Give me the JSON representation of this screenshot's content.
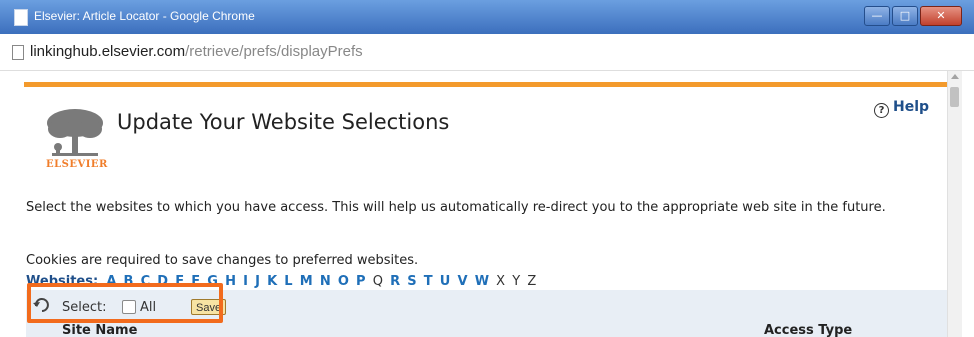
{
  "window": {
    "title": "Elsevier: Article Locator - Google Chrome"
  },
  "address_bar": {
    "host": "linkinghub.elsevier.com",
    "path": "/retrieve/prefs/displayPrefs"
  },
  "page": {
    "logo_text": "ELSEVIER",
    "heading": "Update Your Website Selections",
    "help_label": "Help",
    "intro": "Select the websites to which you have access. This will help us automatically re-direct you to the appropriate web site in the future.",
    "cookies_note": "Cookies are required to save changes to preferred websites.",
    "websites_label": "Websites:",
    "alphabet_active": [
      "A",
      "B",
      "C",
      "D",
      "E",
      "F",
      "G",
      "H",
      "I",
      "J",
      "K",
      "L",
      "M",
      "N",
      "O",
      "P"
    ],
    "letter_q": "Q",
    "alphabet_active_2": [
      "R",
      "S",
      "T",
      "U",
      "V",
      "W"
    ],
    "alphabet_inactive": [
      "X",
      "Y",
      "Z"
    ],
    "select_label": "Select:",
    "all_label": "All",
    "save_label": "Save",
    "col_site_name": "Site Name",
    "col_access_type": "Access Type"
  },
  "colors": {
    "accent_rule": "#f39a2c",
    "highlight": "#f26b1d",
    "link": "#1f6fb8"
  }
}
